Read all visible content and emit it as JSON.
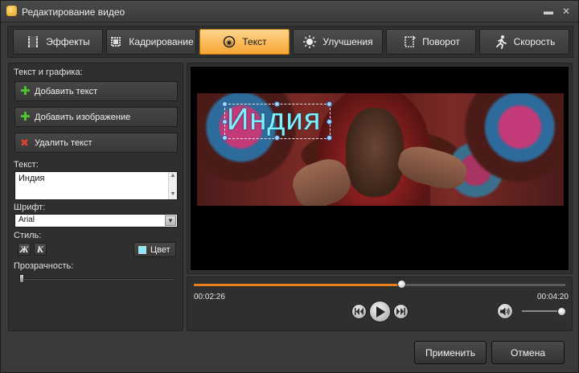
{
  "window": {
    "title": "Редактирование видео"
  },
  "tabs": [
    {
      "label": "Эффекты",
      "icon": "film-icon"
    },
    {
      "label": "Кадрирование",
      "icon": "crop-icon"
    },
    {
      "label": "Текст",
      "icon": "text-icon",
      "active": true
    },
    {
      "label": "Улучшения",
      "icon": "sun-icon"
    },
    {
      "label": "Поворот",
      "icon": "rotate-icon"
    },
    {
      "label": "Скорость",
      "icon": "runner-icon"
    }
  ],
  "left": {
    "section_title": "Текст и графика:",
    "add_text": "Добавить текст",
    "add_image": "Добавить изображение",
    "delete_text": "Удалить текст",
    "text_label": "Текст:",
    "text_value": "Индия",
    "font_label": "Шрифт:",
    "font_value": "Arial",
    "style_label": "Стиль:",
    "bold_glyph": "Ж",
    "italic_glyph": "К",
    "color_label": "Цвет",
    "color_value": "#7ef0ff",
    "opacity_label": "Прозрачность:",
    "opacity_level": 0
  },
  "preview": {
    "overlay_text": "Индия",
    "overlay_color": "#7ef0ff"
  },
  "player": {
    "current_time": "00:02:26",
    "total_time": "00:04:20",
    "progress_fraction": 0.56,
    "volume_fraction": 1.0
  },
  "buttons": {
    "apply": "Применить",
    "cancel": "Отмена"
  },
  "colors": {
    "accent": "#f5a632",
    "progress": "#e8801c"
  }
}
